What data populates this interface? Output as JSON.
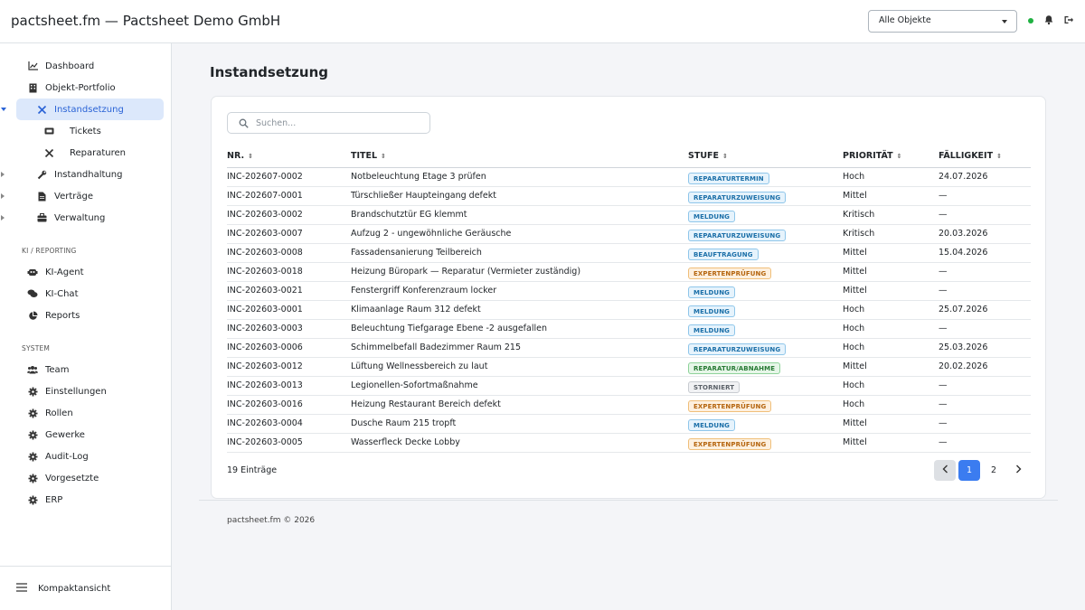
{
  "app": {
    "title": "pactsheet.fm — Pactsheet Demo GmbH"
  },
  "header": {
    "object_select": "Alle Objekte",
    "status_color": "#1fb141"
  },
  "sidebar": {
    "items": [
      {
        "label": "Dashboard",
        "icon": "chart-line-icon"
      },
      {
        "label": "Objekt-Portfolio",
        "icon": "building-icon"
      },
      {
        "label": "Instandsetzung",
        "icon": "tools-icon",
        "active": true,
        "expanded": true
      },
      {
        "label": "Tickets",
        "icon": "ticket-icon"
      },
      {
        "label": "Reparaturen",
        "icon": "tools-icon"
      },
      {
        "label": "Instandhaltung",
        "icon": "wrench-icon"
      },
      {
        "label": "Verträge",
        "icon": "file-icon"
      },
      {
        "label": "Verwaltung",
        "icon": "briefcase-icon"
      }
    ],
    "section_ki": "KI / REPORTING",
    "ki_items": [
      {
        "label": "KI-Agent",
        "icon": "robot-icon"
      },
      {
        "label": "KI-Chat",
        "icon": "comments-icon"
      },
      {
        "label": "Reports",
        "icon": "pie-chart-icon"
      }
    ],
    "section_system": "SYSTEM",
    "system_items": [
      {
        "label": "Team",
        "icon": "users-icon"
      },
      {
        "label": "Einstellungen",
        "icon": "gear-icon"
      },
      {
        "label": "Rollen",
        "icon": "gear-icon"
      },
      {
        "label": "Gewerke",
        "icon": "gear-icon"
      },
      {
        "label": "Audit-Log",
        "icon": "gear-icon"
      },
      {
        "label": "Vorgesetzte",
        "icon": "gear-icon"
      },
      {
        "label": "ERP",
        "icon": "gear-icon"
      }
    ],
    "footer": "Kompaktansicht"
  },
  "main": {
    "page_title": "Instandsetzung",
    "search_placeholder": "Suchen...",
    "columns": [
      "NR.",
      "TITEL",
      "STUFE",
      "PRIORITÄT",
      "FÄLLIGKEIT"
    ],
    "rows": [
      {
        "nr": "INC-202607-0002",
        "title": "Notbeleuchtung Etage 3 prüfen",
        "stage": "REPARATURTERMIN",
        "stage_kind": "blue",
        "priority": "Hoch",
        "due": "24.07.2026"
      },
      {
        "nr": "INC-202607-0001",
        "title": "Türschließer Haupteingang defekt",
        "stage": "REPARATURZUWEISUNG",
        "stage_kind": "blue",
        "priority": "Mittel",
        "due": "—"
      },
      {
        "nr": "INC-202603-0002",
        "title": "Brandschutztür EG klemmt",
        "stage": "MELDUNG",
        "stage_kind": "blue",
        "priority": "Kritisch",
        "due": "—"
      },
      {
        "nr": "INC-202603-0007",
        "title": "Aufzug 2 - ungewöhnliche Geräusche",
        "stage": "REPARATURZUWEISUNG",
        "stage_kind": "blue",
        "priority": "Kritisch",
        "due": "20.03.2026"
      },
      {
        "nr": "INC-202603-0008",
        "title": "Fassadensanierung Teilbereich",
        "stage": "BEAUFTRAGUNG",
        "stage_kind": "blue",
        "priority": "Mittel",
        "due": "15.04.2026"
      },
      {
        "nr": "INC-202603-0018",
        "title": "Heizung Büropark — Reparatur (Vermieter zuständig)",
        "stage": "EXPERTENPRÜFUNG",
        "stage_kind": "orange",
        "priority": "Mittel",
        "due": "—"
      },
      {
        "nr": "INC-202603-0021",
        "title": "Fenstergriff Konferenzraum locker",
        "stage": "MELDUNG",
        "stage_kind": "blue",
        "priority": "Mittel",
        "due": "—"
      },
      {
        "nr": "INC-202603-0001",
        "title": "Klimaanlage Raum 312 defekt",
        "stage": "MELDUNG",
        "stage_kind": "blue",
        "priority": "Hoch",
        "due": "25.07.2026"
      },
      {
        "nr": "INC-202603-0003",
        "title": "Beleuchtung Tiefgarage Ebene -2 ausgefallen",
        "stage": "MELDUNG",
        "stage_kind": "blue",
        "priority": "Hoch",
        "due": "—"
      },
      {
        "nr": "INC-202603-0006",
        "title": "Schimmelbefall Badezimmer Raum 215",
        "stage": "REPARATURZUWEISUNG",
        "stage_kind": "blue",
        "priority": "Hoch",
        "due": "25.03.2026"
      },
      {
        "nr": "INC-202603-0012",
        "title": "Lüftung Wellnessbereich zu laut",
        "stage": "REPARATUR/ABNAHME",
        "stage_kind": "green",
        "priority": "Mittel",
        "due": "20.02.2026"
      },
      {
        "nr": "INC-202603-0013",
        "title": "Legionellen-Sofortmaßnahme",
        "stage": "STORNIERT",
        "stage_kind": "gray",
        "priority": "Hoch",
        "due": "—"
      },
      {
        "nr": "INC-202603-0016",
        "title": "Heizung Restaurant Bereich defekt",
        "stage": "EXPERTENPRÜFUNG",
        "stage_kind": "orange",
        "priority": "Hoch",
        "due": "—"
      },
      {
        "nr": "INC-202603-0004",
        "title": "Dusche Raum 215 tropft",
        "stage": "MELDUNG",
        "stage_kind": "blue",
        "priority": "Mittel",
        "due": "—"
      },
      {
        "nr": "INC-202603-0005",
        "title": "Wasserfleck Decke Lobby",
        "stage": "EXPERTENPRÜFUNG",
        "stage_kind": "orange",
        "priority": "Mittel",
        "due": "—"
      }
    ],
    "entries_count": "19 Einträge",
    "pagination": {
      "pages": [
        "1",
        "2"
      ],
      "current": "1"
    }
  },
  "footer": {
    "copyright": "pactsheet.fm © 2026"
  },
  "badge_colors": {
    "blue": {
      "bg": "#e6f3fc",
      "border": "#8fc6ea",
      "text": "#1b6fa8"
    },
    "orange": {
      "bg": "#fdf0df",
      "border": "#f0bf7a",
      "text": "#b5650e"
    },
    "green": {
      "bg": "#e6f6e8",
      "border": "#8ed39a",
      "text": "#277a34"
    },
    "gray": {
      "bg": "#f1f2f4",
      "border": "#c8ccd1",
      "text": "#5b6168"
    }
  }
}
